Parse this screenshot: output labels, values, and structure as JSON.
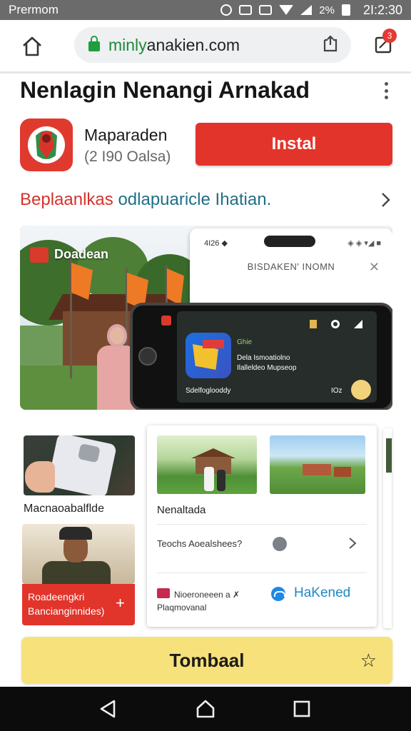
{
  "status_bar": {
    "carrier": "Prermom",
    "battery": "2%",
    "time": "2I:2:30"
  },
  "browser": {
    "url_host": "minly",
    "url_rest": "anakien.com",
    "tab_badge": "3"
  },
  "app": {
    "title": "Nenlagin Nenangi Arnakad",
    "developer": "Maparaden",
    "sub": "(2 I90 Oalsa)",
    "install_label": "Instal",
    "promo_red": "Beplaanlkas",
    "promo_teal": "odlapuaricle Ihatian."
  },
  "banner": {
    "label": "Doadean",
    "dialog_status": "4I26 ◆",
    "dialog_icons": "◈ ◈ ▾◢ ■",
    "dialog_title": "BISDAKEN' INOMN",
    "screen_t1": "Ghie",
    "screen_t2": "Dela Ismoatiolno",
    "screen_t3": "Ilalleldeo Mupseop",
    "screen_t4": "Sdelfoglooddy",
    "screen_t5": "IOz"
  },
  "cards": {
    "left_caption": "Macnaoabalflde",
    "red_line1": "Roadeengkri",
    "red_line2": "Bancianginnides)",
    "red_plus": "+",
    "panel_name": "Nenaltada",
    "panel_row1": "Teochs Aoealshees?",
    "panel_row2_line1": "Nioeroneeen a ✗",
    "panel_row2_line2": "Plaqmovanal",
    "panel_link": "HaKened"
  },
  "cta": {
    "label": "Tombaal",
    "star": "☆"
  },
  "colors": {
    "accent_red": "#e3342b",
    "cta_yellow": "#f7e17a",
    "link_blue": "#1e88c5",
    "secure_green": "#1e9e3e"
  }
}
